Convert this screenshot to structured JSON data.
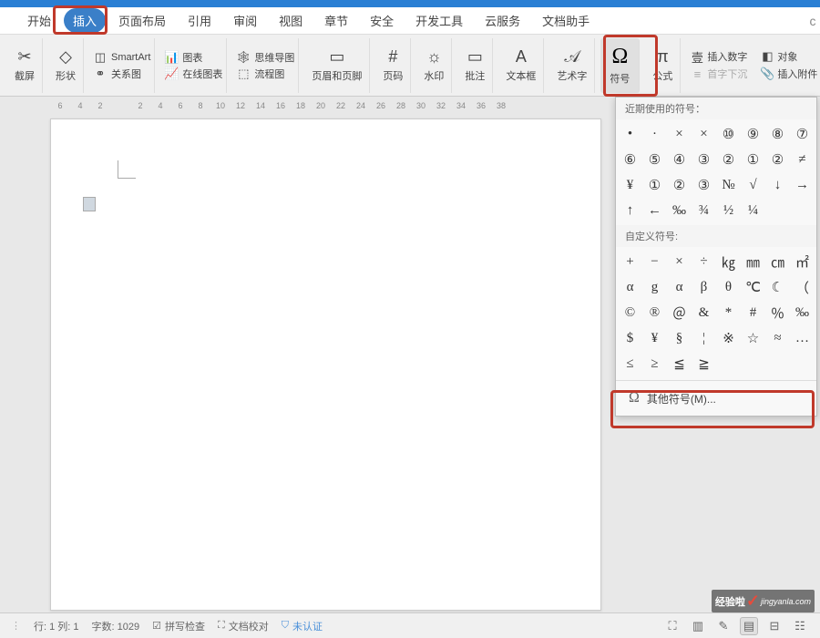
{
  "menu": {
    "items": [
      "开始",
      "插入",
      "页面布局",
      "引用",
      "审阅",
      "视图",
      "章节",
      "安全",
      "开发工具",
      "云服务",
      "文档助手"
    ],
    "active_index": 1
  },
  "ribbon": {
    "screenshot": "截屏",
    "shape": "形状",
    "smartart": "SmartArt",
    "relation": "关系图",
    "chart": "图表",
    "online_chart": "在线图表",
    "mindmap": "思维导图",
    "flowchart": "流程图",
    "header_footer": "页眉和页脚",
    "page_number": "页码",
    "watermark": "水印",
    "annotation": "批注",
    "textbox": "文本框",
    "wordart": "艺术字",
    "symbol": "符号",
    "formula": "公式",
    "insert_number": "插入数字",
    "object": "对象",
    "first_underline": "首字下沉",
    "insert_attachment": "插入附件"
  },
  "ruler": [
    "6",
    "4",
    "2",
    "",
    "2",
    "4",
    "6",
    "8",
    "10",
    "12",
    "14",
    "16",
    "18",
    "20",
    "22",
    "24",
    "26",
    "28",
    "30",
    "32",
    "34",
    "36",
    "38",
    ""
  ],
  "symbol_panel": {
    "recent_label": "近期使用的符号：",
    "recent_symbols": [
      "•",
      "·",
      "×",
      "×",
      "⑩",
      "⑨",
      "⑧",
      "⑦",
      "⑥",
      "⑤",
      "④",
      "③",
      "②",
      "①",
      "②",
      "≠",
      "¥",
      "①",
      "②",
      "③",
      "№",
      "√",
      "↓",
      "→",
      "↑",
      "←",
      "‰",
      "¾",
      "½",
      "¼",
      "",
      ""
    ],
    "custom_label": "自定义符号:",
    "custom_symbols": [
      "+",
      "−",
      "×",
      "÷",
      "㎏",
      "㎜",
      "㎝",
      "㎡",
      "α",
      "g",
      "α",
      "β",
      "θ",
      "℃",
      "☾",
      "（",
      "©",
      "®",
      "＠",
      "&",
      "*",
      "#",
      "％",
      "‰",
      "$",
      "¥",
      "§",
      "¦",
      "※",
      "☆",
      "≈",
      "…",
      "≤",
      "≥",
      "≦",
      "≧",
      "",
      "",
      "",
      ""
    ],
    "more": "其他符号(M)..."
  },
  "status": {
    "line_col": "行: 1  列: 1",
    "word_count": "字数: 1029",
    "spell_check": "拼写检查",
    "doc_proof": "文档校对",
    "not_auth": "未认证"
  },
  "watermark": {
    "label": "经验啦",
    "url": "jingyanla.com"
  }
}
